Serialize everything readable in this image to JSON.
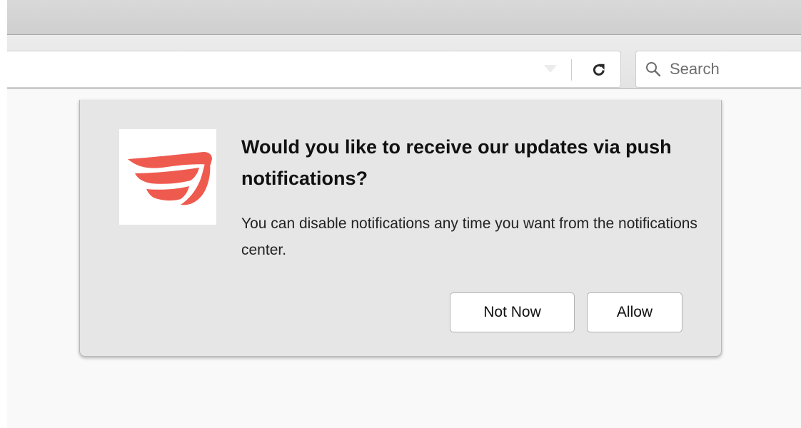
{
  "toolbar": {
    "search_placeholder": "Search",
    "icons": {
      "reload": "reload-icon",
      "search": "search-icon",
      "dropdown": "dropdown-arrow-icon"
    }
  },
  "notification": {
    "title": "Would you like to receive our updates via push notifications?",
    "body": "You can disable notifications any time you want from the notifications center.",
    "logo_icon": "wing-logo-icon",
    "not_now_label": "Not Now",
    "allow_label": "Allow"
  },
  "colors": {
    "logo_accent": "#ef5a4f",
    "popup_background": "#e6e6e6",
    "toolbar_background": "#e6e6e6",
    "tabbar_background": "#d3d3d3"
  }
}
